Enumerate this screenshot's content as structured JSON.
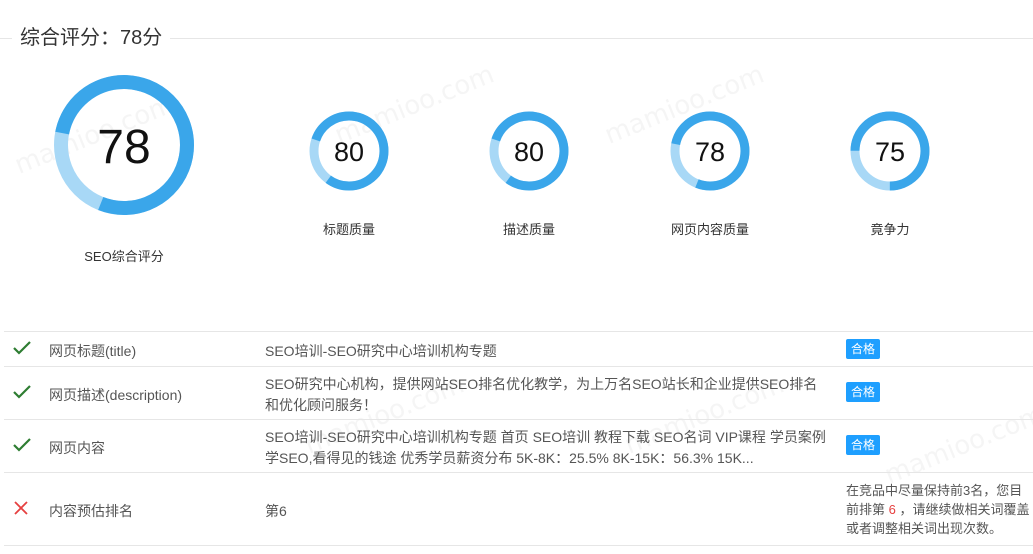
{
  "header": {
    "title": "综合评分：78分"
  },
  "watermark": "mamioo.com",
  "colors": {
    "accent": "#3aa6ea",
    "track": "#a8d8f6",
    "pass": "#1e9fff",
    "check": "#2e7d32",
    "fail": "#e64040"
  },
  "gauges": {
    "main": {
      "value": "78",
      "percent": 78,
      "label": "SEO综合评分"
    },
    "title_quality": {
      "value": "80",
      "percent": 80,
      "label": "标题质量"
    },
    "desc_quality": {
      "value": "80",
      "percent": 80,
      "label": "描述质量"
    },
    "content_quality": {
      "value": "78",
      "percent": 78,
      "label": "网页内容质量"
    },
    "competitiveness": {
      "value": "75",
      "percent": 75,
      "label": "竟争力"
    }
  },
  "table": {
    "rows": [
      {
        "status": "check-icon",
        "name": "网页标题(title)",
        "value1": "SEO培训-SEO研究中心培训机构专题",
        "result": "合格"
      },
      {
        "status": "check-icon",
        "name": "网页描述(description)",
        "value1": "SEO研究中心机构，提供网站SEO排名优化教学，为上万名SEO站长和企业提供SEO排名",
        "value2": "和优化顾问服务！",
        "result": "合格"
      },
      {
        "status": "check-icon",
        "name": "网页内容",
        "value1": "SEO培训-SEO研究中心培训机构专题 首页 SEO培训 教程下载 SEO名词 VIP课程 学员案例",
        "value2": "学SEO,看得见的钱途 优秀学员薪资分布 5K-8K：25.5% 8K-15K：56.3% 15K...",
        "result": "合格"
      },
      {
        "status": "cross-icon",
        "name": "内容预估排名",
        "value1": "第6",
        "advice": {
          "line1": "在竞品中尽量保持前3名，您目",
          "line2_pre": "前排第 ",
          "line2_rank": "6",
          "line2_post": " ，请继续做相关词覆盖",
          "line3": "或者调整相关词出现次数。"
        }
      }
    ]
  }
}
